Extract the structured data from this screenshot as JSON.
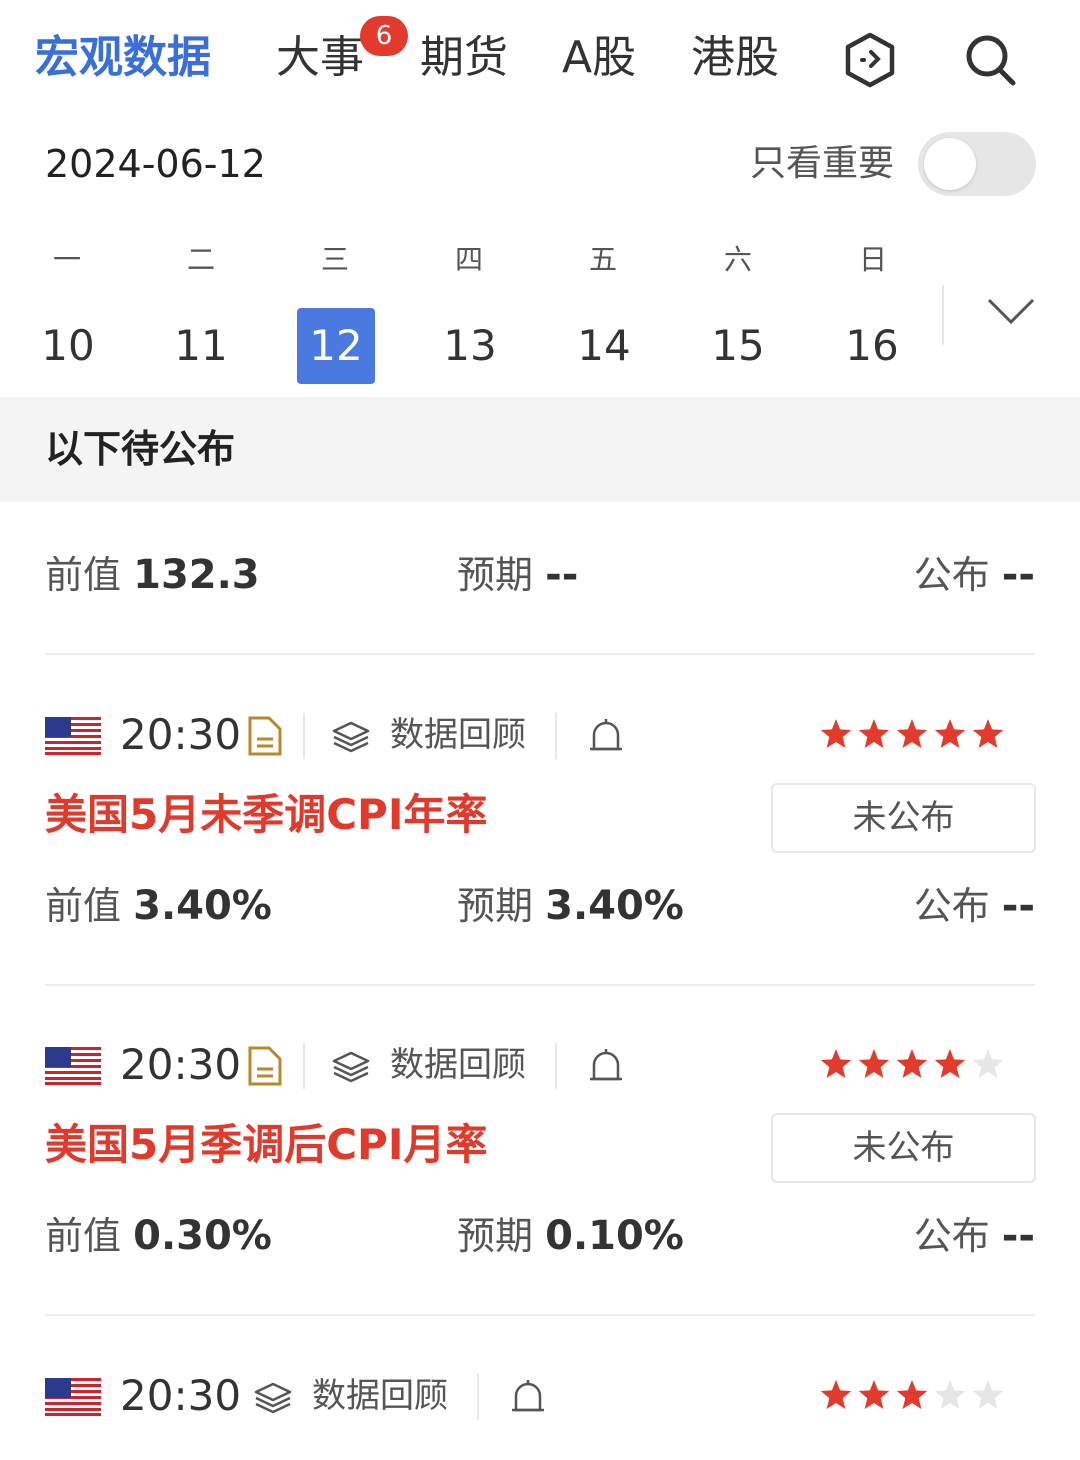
{
  "nav": {
    "tabs": [
      "宏观数据",
      "大事",
      "期货",
      "A股",
      "港股"
    ],
    "badge": "6",
    "icons": [
      "hexagon-icon",
      "search-icon"
    ]
  },
  "date": {
    "current": "2024-06-12",
    "only_important_label": "只看重要",
    "only_important_on": false
  },
  "week": {
    "labels": [
      "一",
      "二",
      "三",
      "四",
      "五",
      "六",
      "日"
    ],
    "days": [
      "10",
      "11",
      "12",
      "13",
      "14",
      "15",
      "16"
    ],
    "selected_index": 2
  },
  "section": {
    "title": "以下待公布"
  },
  "prev_row": {
    "prev_label": "前值",
    "prev_value": "132.3",
    "exp_label": "预期",
    "exp_value": "--",
    "pub_label": "公布",
    "pub_value": "--"
  },
  "events": [
    {
      "time": "20:30",
      "has_doc": true,
      "review_label": "数据回顾",
      "rating": 5,
      "title": "美国5月未季调CPI年率",
      "status": "未公布",
      "prev_label": "前值",
      "prev_value": "3.40%",
      "exp_label": "预期",
      "exp_value": "3.40%",
      "pub_label": "公布",
      "pub_value": "--"
    },
    {
      "time": "20:30",
      "has_doc": true,
      "review_label": "数据回顾",
      "rating": 4,
      "title": "美国5月季调后CPI月率",
      "status": "未公布",
      "prev_label": "前值",
      "prev_value": "0.30%",
      "exp_label": "预期",
      "exp_value": "0.10%",
      "pub_label": "公布",
      "pub_value": "--"
    },
    {
      "time": "20:30",
      "has_doc": false,
      "review_label": "数据回顾",
      "rating": 3
    }
  ],
  "colors": {
    "accent": "#3b6fd8",
    "title_red": "#e03a2d",
    "star_on": "#e23a2c",
    "star_off": "#e6e6e6"
  }
}
